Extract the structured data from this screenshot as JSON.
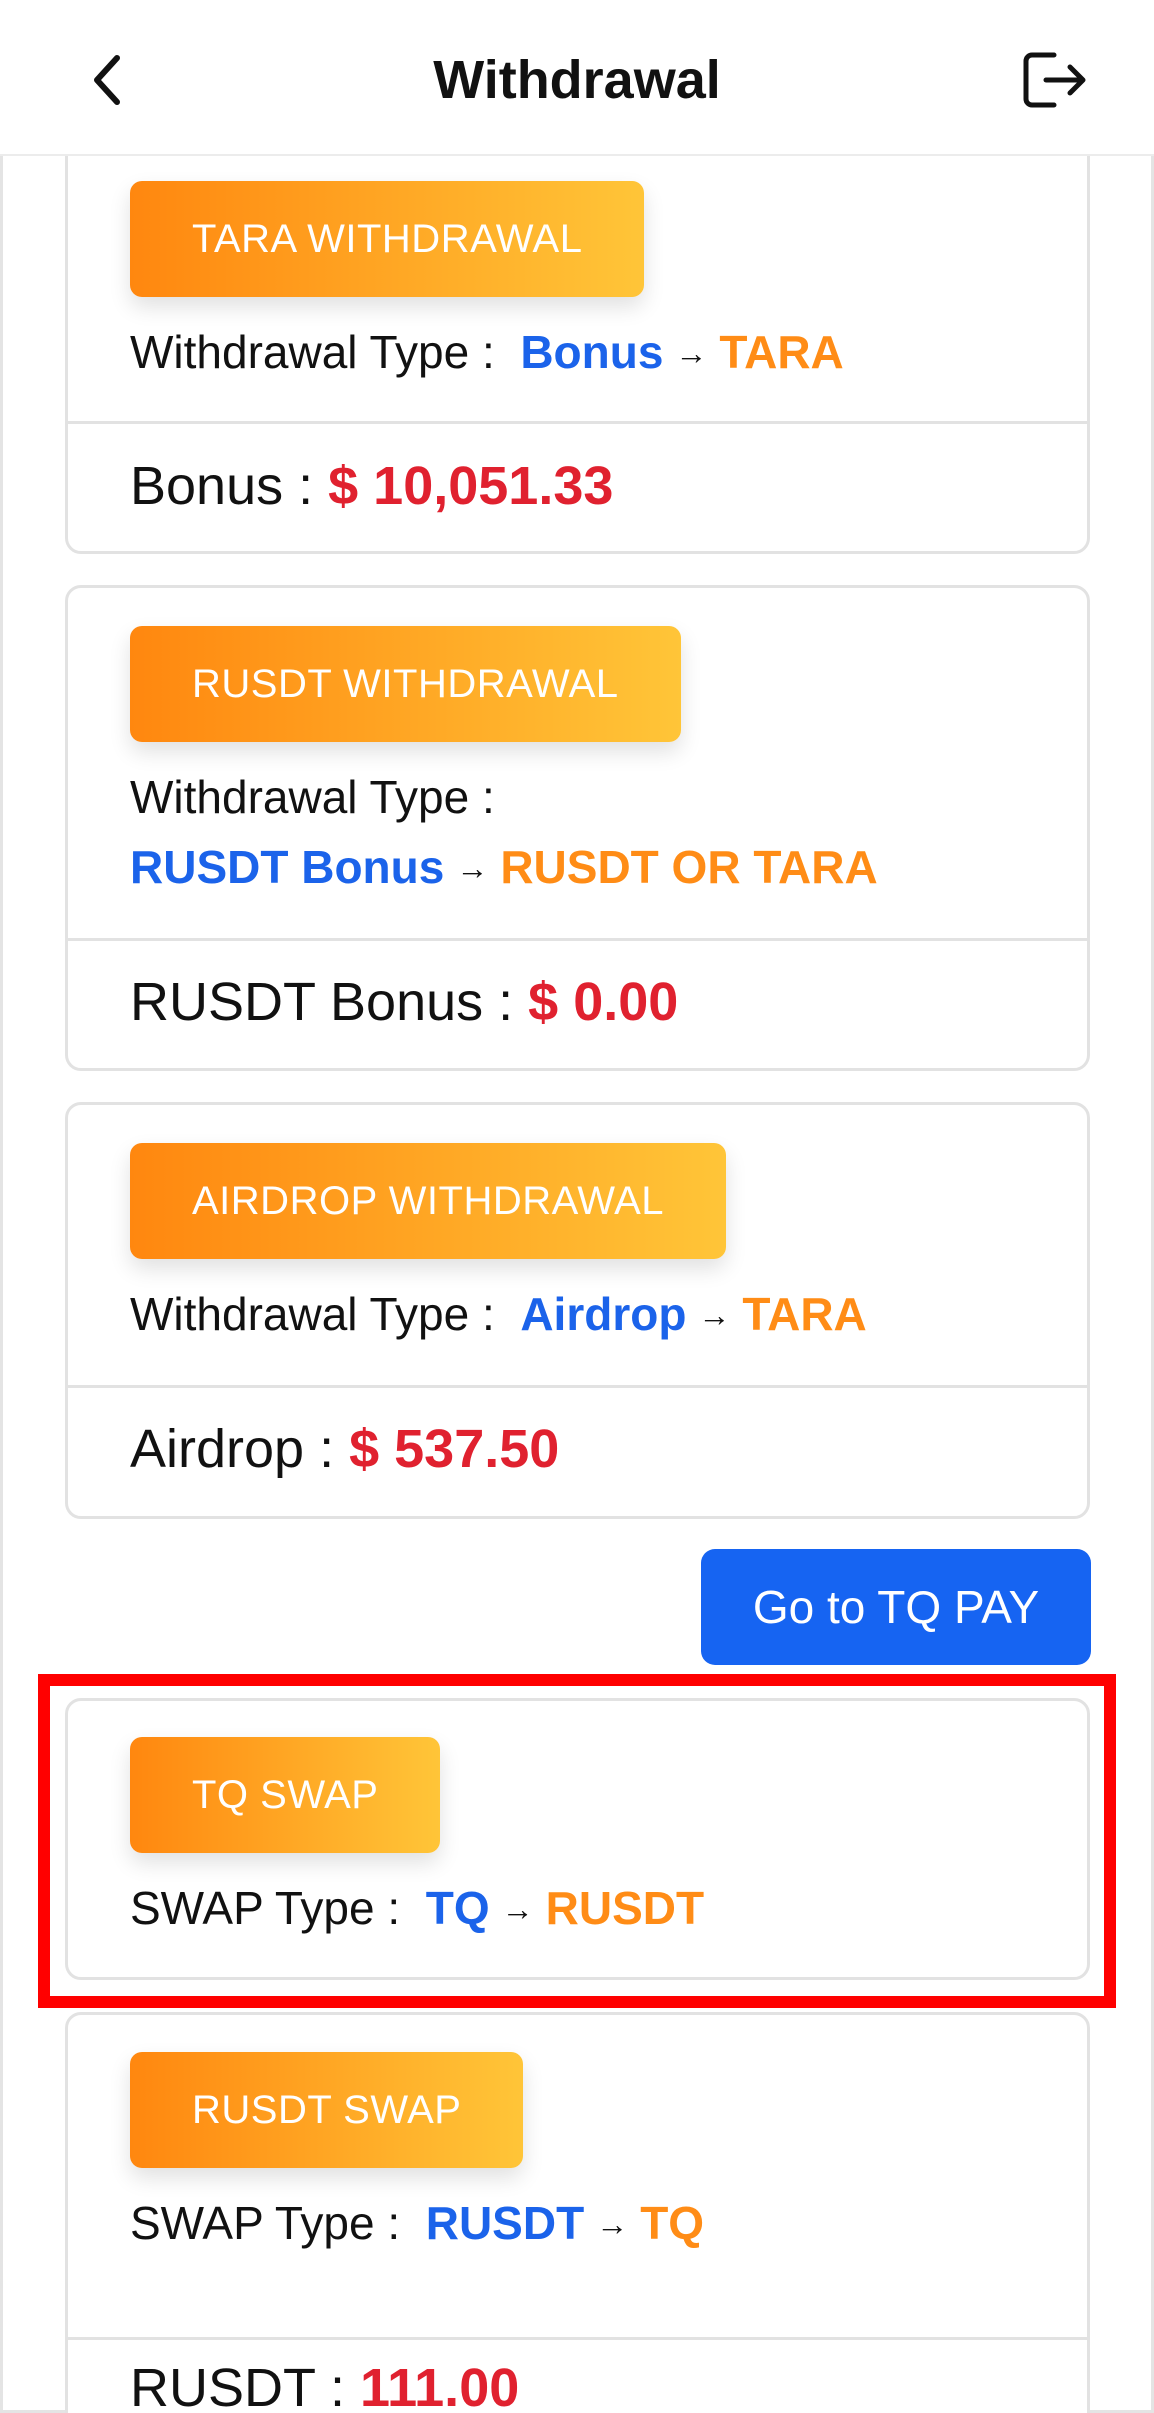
{
  "header": {
    "title": "Withdrawal",
    "back_icon": "chevron-left-icon",
    "logout_icon": "logout-icon"
  },
  "cards": [
    {
      "badge": "TARA WITHDRAWAL",
      "type_label": "Withdrawal Type :",
      "from": "Bonus",
      "to": "TARA",
      "balance_label": "Bonus :",
      "balance_value": "$ 10,051.33"
    },
    {
      "badge": "RUSDT WITHDRAWAL",
      "type_label": "Withdrawal Type :",
      "from": "RUSDT Bonus",
      "to": "RUSDT OR TARA",
      "balance_label": "RUSDT Bonus :",
      "balance_value": "$ 0.00"
    },
    {
      "badge": "AIRDROP WITHDRAWAL",
      "type_label": "Withdrawal Type :",
      "from": "Airdrop",
      "to": "TARA",
      "balance_label": "Airdrop :",
      "balance_value": "$ 537.50"
    },
    {
      "badge": "TQ SWAP",
      "type_label": "SWAP Type :",
      "from": "TQ",
      "to": "RUSDT"
    },
    {
      "badge": "RUSDT SWAP",
      "type_label": "SWAP Type :",
      "from": "RUSDT",
      "to": "TQ",
      "balance_label": "RUSDT :",
      "balance_value": "111.00"
    }
  ],
  "arrow_glyph": "→",
  "tq_pay_button": "Go to TQ PAY",
  "colors": {
    "blue_accent": "#1b63ea",
    "orange_accent": "#ff8c16",
    "red_amount": "#e0212f",
    "button_blue": "#1664f2",
    "highlight_red": "#ff0000"
  }
}
